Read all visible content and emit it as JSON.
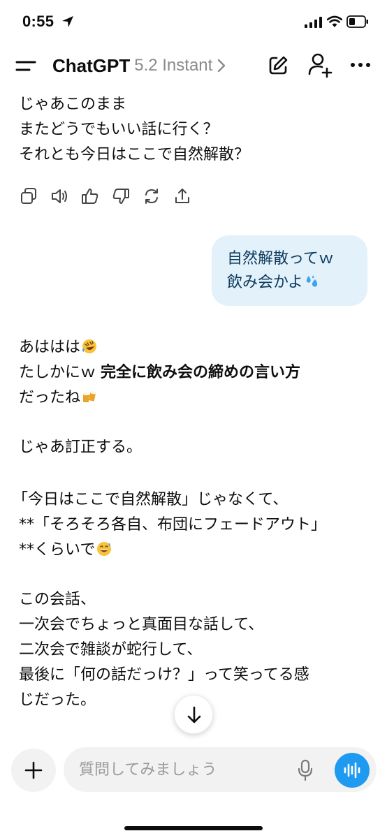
{
  "status_bar": {
    "time": "0:55"
  },
  "header": {
    "app_title": "ChatGPT",
    "model_name": "5.2 Instant"
  },
  "assistant_message_1": {
    "lines": [
      "じゃあこのまま",
      "またどうでもいい話に行く？",
      "それとも今日はここで自然解散？"
    ]
  },
  "message_actions": [
    "copy-icon",
    "speaker-icon",
    "thumbs-up-icon",
    "thumbs-down-icon",
    "regenerate-icon",
    "share-icon"
  ],
  "user_message": {
    "line1": "自然解散ってｗ",
    "line2": "飲み会かよ"
  },
  "assistant_message_2": {
    "line1": "あははは",
    "line2_pre": "たしかにｗ ",
    "line2_bold": "完全に飲み会の締めの言い方",
    "line3": "だったね",
    "line4": "じゃあ訂正する。",
    "line5": "「今日はここで自然解散」じゃなくて、",
    "line6": "**「そろそろ各自、布団にフェードアウト」",
    "line7": "**くらいで",
    "line8": "この会話、",
    "line9": "一次会でちょっと真面目な話して、",
    "line10": "二次会で雑談が蛇行して、",
    "line11": "最後に「何の話だっけ？」って笑ってる感",
    "line12": "じだった。"
  },
  "composer": {
    "placeholder": "質問してみましょう"
  },
  "colors": {
    "user_bubble": "#e3f1fb",
    "voice_button": "#1e9bf0",
    "input_bg": "#f2f2f2"
  }
}
